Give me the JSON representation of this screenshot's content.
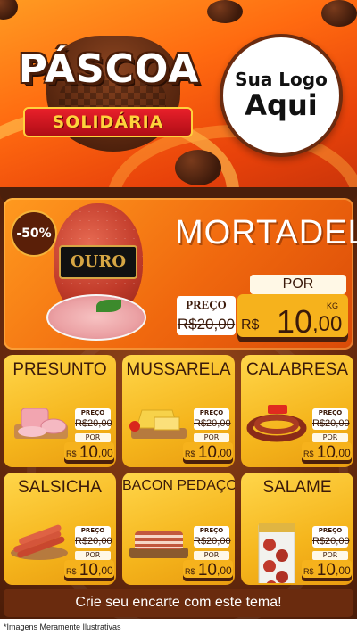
{
  "header": {
    "title": "PÁSCOA",
    "subtitle": "SOLIDÁRIA",
    "logo_line1": "Sua Logo",
    "logo_line2": "Aqui"
  },
  "featured": {
    "discount": "-50%",
    "brand_label": "OURO",
    "name": "MORTADELA",
    "preco_label": "PREÇO",
    "old_price": "R$20,00",
    "por_label": "POR",
    "currency": "R$",
    "price_int": "10",
    "price_dec": ",00",
    "unit": "KG"
  },
  "products": [
    {
      "name": "PRESUNTO",
      "preco_label": "PREÇO",
      "old_price": "R$20,00",
      "por_label": "POR",
      "currency": "R$",
      "price_int": "10",
      "price_dec": ",00",
      "icon": "ham-slices-icon"
    },
    {
      "name": "MUSSARELA",
      "preco_label": "PREÇO",
      "old_price": "R$20,00",
      "por_label": "POR",
      "currency": "R$",
      "price_int": "10",
      "price_dec": ",00",
      "icon": "cheese-icon"
    },
    {
      "name": "CALABRESA",
      "preco_label": "PREÇO",
      "old_price": "R$20,00",
      "por_label": "POR",
      "currency": "R$",
      "price_int": "10",
      "price_dec": ",00",
      "icon": "sausage-ring-icon"
    },
    {
      "name": "SALSICHA",
      "preco_label": "PREÇO",
      "old_price": "R$20,00",
      "por_label": "POR",
      "currency": "R$",
      "price_int": "10",
      "price_dec": ",00",
      "icon": "hot-dog-sausages-icon"
    },
    {
      "name": "BACON PEDAÇO",
      "preco_label": "PREÇO",
      "old_price": "R$20,00",
      "por_label": "POR",
      "currency": "R$",
      "price_int": "10",
      "price_dec": ",00",
      "icon": "bacon-icon"
    },
    {
      "name": "SALAME",
      "preco_label": "PREÇO",
      "old_price": "R$20,00",
      "por_label": "POR",
      "currency": "R$",
      "price_int": "10",
      "price_dec": ",00",
      "icon": "salami-package-icon"
    }
  ],
  "cta": "Crie seu encarte com este tema!",
  "disclaimer": "*Imagens Meramente Ilustrativas",
  "colors": {
    "orange": "#f0680e",
    "chocolate": "#6a2b0e",
    "yellow": "#f5b51c",
    "red": "#e8202a"
  }
}
